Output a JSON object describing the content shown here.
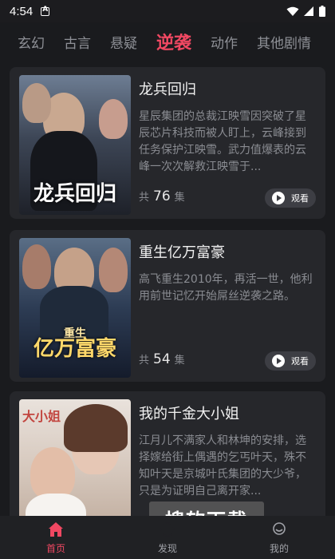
{
  "status_bar": {
    "time": "4:54"
  },
  "tabs": [
    {
      "label": "玄幻",
      "active": false
    },
    {
      "label": "古言",
      "active": false
    },
    {
      "label": "悬疑",
      "active": false
    },
    {
      "label": "逆袭",
      "active": true
    },
    {
      "label": "动作",
      "active": false
    },
    {
      "label": "其他剧情",
      "active": false
    }
  ],
  "dramas": [
    {
      "title": "龙兵回归",
      "description": "星辰集团的总裁江映雪因突破了星辰芯片科技而被人盯上，云峰接到任务保护江映雪。武力值爆表的云峰一次次解救江映雪于...",
      "episodes_prefix": "共",
      "episodes": "76",
      "episodes_suffix": "集",
      "watch_label": "观看",
      "poster_text": "龙兵回归"
    },
    {
      "title": "重生亿万富豪",
      "description": "高飞重生2010年，再活一世，他利用前世记忆开始屌丝逆袭之路。",
      "episodes_prefix": "共",
      "episodes": "54",
      "episodes_suffix": "集",
      "watch_label": "观看",
      "poster_text": "亿万富豪",
      "poster_subtext": "重生"
    },
    {
      "title": "我的千金大小姐",
      "description": "江月儿不满家人和林坤的安排，选择嫁给街上偶遇的乞丐叶天，殊不知叶天是京城叶氏集团的大少爷，只是为证明自己离开家...",
      "poster_text": "大小姐"
    }
  ],
  "watermark": "搜软下载",
  "bottom_nav": [
    {
      "label": "首页",
      "icon": "home-icon",
      "active": true
    },
    {
      "label": "发现",
      "icon": "discover-icon",
      "active": false
    },
    {
      "label": "我的",
      "icon": "profile-icon",
      "active": false
    }
  ],
  "colors": {
    "accent": "#f04862",
    "background": "#1a1b1e",
    "card": "#26272b"
  }
}
